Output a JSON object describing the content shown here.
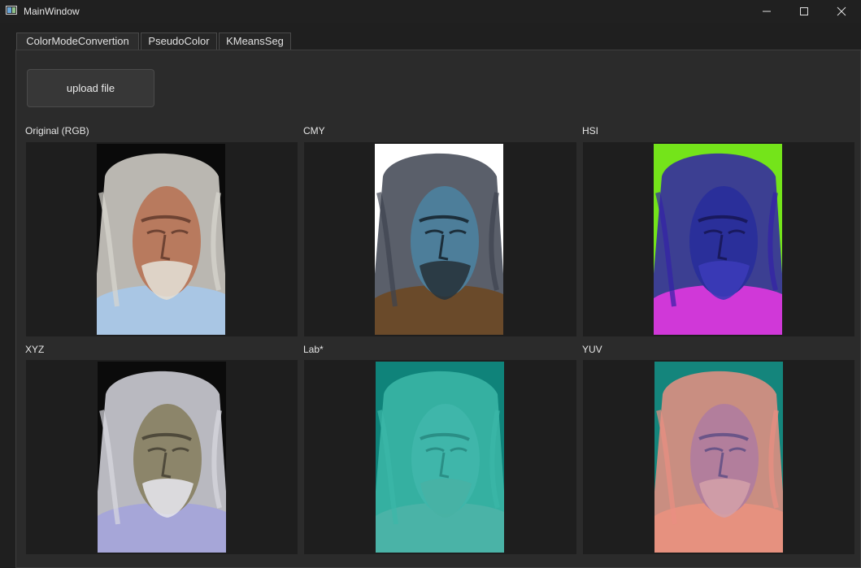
{
  "window": {
    "title": "MainWindow"
  },
  "tabs": [
    {
      "label": "ColorModeConvertion",
      "active": true
    },
    {
      "label": "PseudoColor",
      "active": false
    },
    {
      "label": "KMeansSeg",
      "active": false
    }
  ],
  "upload_button": {
    "label": "upload file"
  },
  "panels": [
    {
      "label": "Original (RGB)",
      "palette": {
        "bg": "#0a0a0a",
        "hair": "#d9d6cf",
        "skin": "#b87a5e",
        "shade": "#6e4333",
        "shirt": "#a9c6e4",
        "beard": "#e2ddd3"
      }
    },
    {
      "label": "CMY",
      "palette": {
        "bg": "#ffffff",
        "hair": "#3d4350",
        "skin": "#4d7e9a",
        "shade": "#1c2e3a",
        "shirt": "#6a4a2a",
        "beard": "#28343c"
      }
    },
    {
      "label": "HSI",
      "palette": {
        "bg": "#74e41a",
        "hair": "#3322a8",
        "skin": "#2a2f9a",
        "shade": "#19195e",
        "shirt": "#d038d8",
        "beard": "#3b3bb8"
      }
    },
    {
      "label": "XYZ",
      "palette": {
        "bg": "#0b0b0b",
        "hair": "#d8d8e0",
        "skin": "#8c856a",
        "shade": "#4f4a3b",
        "shirt": "#a6a6d8",
        "beard": "#e3e3ea"
      }
    },
    {
      "label": "Lab*",
      "palette": {
        "bg": "#0f837a",
        "hair": "#3cb8a8",
        "skin": "#3fb6aa",
        "shade": "#2a8f86",
        "shirt": "#4ab3a7",
        "beard": "#48b1a4"
      }
    },
    {
      "label": "YUV",
      "palette": {
        "bg": "#14857c",
        "hair": "#e98f82",
        "skin": "#b27e9c",
        "shade": "#6b5588",
        "shirt": "#e6917f",
        "beard": "#d1a0a8"
      }
    }
  ]
}
